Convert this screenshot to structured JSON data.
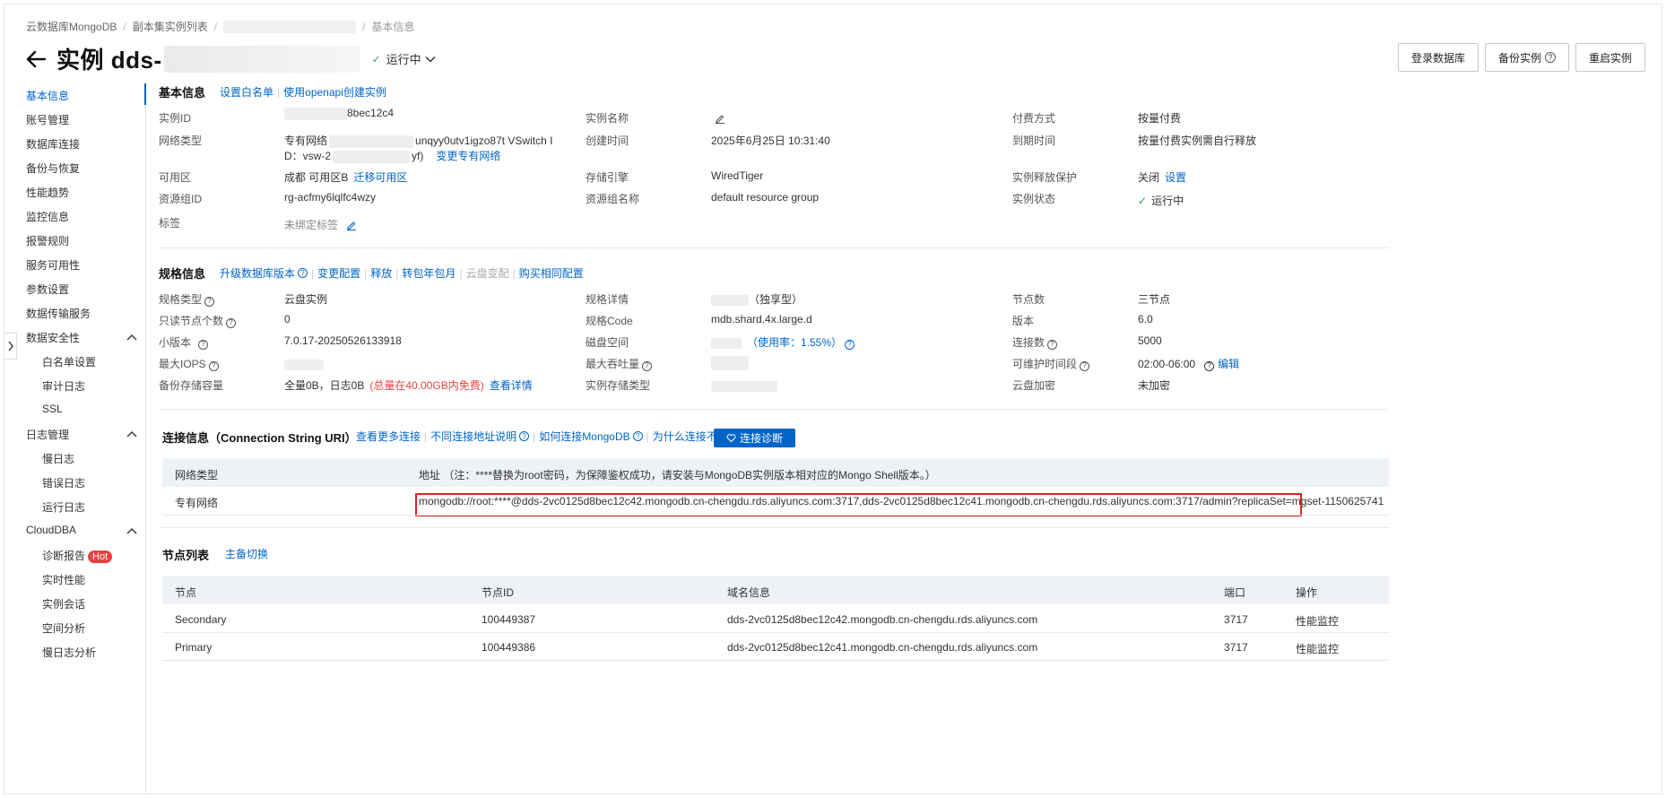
{
  "breadcrumb": {
    "root": "云数据库MongoDB",
    "list": "副本集实例列表",
    "current": "基本信息"
  },
  "title": {
    "prefix": "实例 dds-",
    "status": "运行中"
  },
  "actions": {
    "login": "登录数据库",
    "backup": "备份实例",
    "restart": "重启实例"
  },
  "sidebar": {
    "items": [
      "基本信息",
      "账号管理",
      "数据库连接",
      "备份与恢复",
      "性能趋势",
      "监控信息",
      "报警规则",
      "服务可用性",
      "参数设置",
      "数据传输服务"
    ],
    "security": {
      "label": "数据安全性",
      "children": [
        "白名单设置",
        "审计日志",
        "SSL"
      ]
    },
    "logs": {
      "label": "日志管理",
      "children": [
        "慢日志",
        "错误日志",
        "运行日志"
      ]
    },
    "cloudDBA": {
      "label": "CloudDBA",
      "children": [
        "诊断报告",
        "实时性能",
        "实例会话",
        "空间分析",
        "慢日志分析"
      ],
      "hot": "Hot"
    }
  },
  "basic": {
    "title": "基本信息",
    "link1": "设置白名单",
    "link2": "使用openapi创建实例",
    "instanceIdLabel": "实例ID",
    "instanceIdValue": "8bec12c4",
    "networkLabel": "网络类型",
    "networkLine1a": "专有网络",
    "networkLine1b": "unqyy0utv1igzo87t VSwitch I",
    "networkLine2a": "D：vsw-2",
    "networkLine2b": "yf)",
    "changeVpc": "变更专有网络",
    "zoneLabel": "可用区",
    "zoneValue": "成都 可用区B",
    "migrateZone": "迁移可用区",
    "rgIdLabel": "资源组ID",
    "rgIdValue": "rg-acfmy6lqlfc4wzy",
    "tagLabel": "标签",
    "tagValue": "未绑定标签",
    "nameLabel": "实例名称",
    "createLabel": "创建时间",
    "createValue": "2025年6月25日 10:31:40",
    "engineLabel": "存储引擎",
    "engineValue": "WiredTiger",
    "rgNameLabel": "资源组名称",
    "rgNameValue": "default resource group",
    "payLabel": "付费方式",
    "payValue": "按量付费",
    "expireLabel": "到期时间",
    "expireValue": "按量付费实例需自行释放",
    "releaseLabel": "实例释放保护",
    "releaseValue": "关闭",
    "releaseSet": "设置",
    "statusLabel": "实例状态",
    "statusValue": "运行中"
  },
  "spec": {
    "title": "规格信息",
    "links": [
      "升级数据库版本",
      "变更配置",
      "释放",
      "转包年包月",
      "云盘变配",
      "购买相同配置"
    ],
    "typeLabel": "规格类型",
    "typeValue": "云盘实例",
    "roLabel": "只读节点个数",
    "roValue": "0",
    "minorLabel": "小版本",
    "minorValue": "7.0.17-20250526133918",
    "iopsLabel": "最大IOPS",
    "backupLabel": "备份存储容量",
    "backupValue": "全量0B，日志0B",
    "backupFree": "(总量在40.00GB内免费)",
    "backupDetail": "查看详情",
    "detailLabel": "规格详情",
    "detailValue": "（独享型）",
    "codeLabel": "规格Code",
    "codeValue": "mdb.shard.4x.large.d",
    "diskLabel": "磁盘空间",
    "diskUsage": "（使用率：1.55%）",
    "throughputLabel": "最大吞吐量",
    "storeTypeLabel": "实例存储类型",
    "nodesLabel": "节点数",
    "nodesValue": "三节点",
    "versionLabel": "版本",
    "versionValue": "6.0",
    "connLabel": "连接数",
    "connValue": "5000",
    "maintLabel": "可维护时间段",
    "maintValue": "02:00-06:00",
    "maintEdit": "编辑",
    "encLabel": "云盘加密",
    "encValue": "未加密"
  },
  "conn": {
    "title": "连接信息（Connection String URI）",
    "links": [
      "查看更多连接",
      "不同连接地址说明",
      "如何连接MongoDB",
      "为什么连接不上"
    ],
    "diagnose": "连接诊断",
    "headType": "网络类型",
    "headAddr": "地址 （注：****替换为root密码，为保障鉴权成功，请安装与MongoDB实例版本相对应的Mongo Shell版本。）",
    "rowType": "专有网络",
    "rowAddr": "mongodb://root:****@dds-2vc0125d8bec12c42.mongodb.cn-chengdu.rds.aliyuncs.com:3717,dds-2vc0125d8bec12c41.mongodb.cn-chengdu.rds.aliyuncs.com:3717/admin?replicaSet=mgset-1150625741"
  },
  "nodes": {
    "title": "节点列表",
    "switch": "主备切换",
    "headers": [
      "节点",
      "节点ID",
      "域名信息",
      "端口",
      "操作"
    ],
    "rows": [
      {
        "node": "Secondary",
        "id": "100449387",
        "domain": "dds-2vc0125d8bec12c42.mongodb.cn-chengdu.rds.aliyuncs.com",
        "port": "3717",
        "op": "性能监控"
      },
      {
        "node": "Primary",
        "id": "100449386",
        "domain": "dds-2vc0125d8bec12c41.mongodb.cn-chengdu.rds.aliyuncs.com",
        "port": "3717",
        "op": "性能监控"
      }
    ]
  },
  "colors": {
    "link": "#0064c8",
    "success": "#27a35a",
    "danger": "#e84141"
  }
}
